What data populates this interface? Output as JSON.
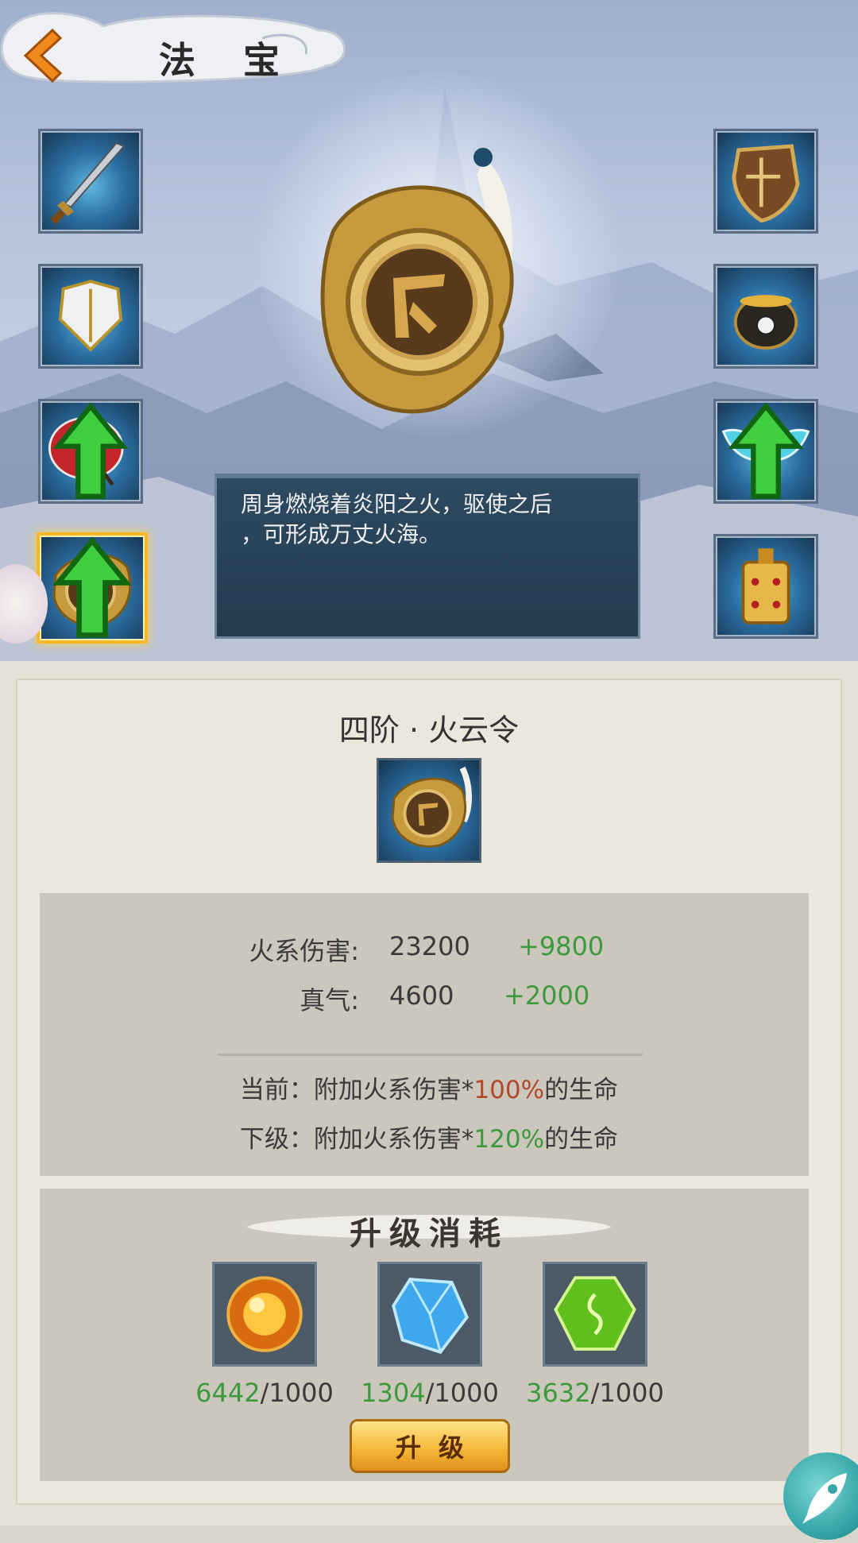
{
  "header": {
    "title": "法 宝",
    "back_icon": "chevron-left-icon"
  },
  "left_slots": [
    {
      "name": "sword",
      "icon": "sword-icon",
      "upgradable": false,
      "selected": false
    },
    {
      "name": "armor",
      "icon": "armor-icon",
      "upgradable": false,
      "selected": false
    },
    {
      "name": "umbrella",
      "icon": "umbrella-icon",
      "upgradable": true,
      "selected": false
    },
    {
      "name": "huoyunling",
      "icon": "medallion-icon",
      "upgradable": true,
      "selected": true
    }
  ],
  "right_slots": [
    {
      "name": "shield",
      "icon": "shield-icon",
      "upgradable": false
    },
    {
      "name": "cauldron",
      "icon": "cauldron-icon",
      "upgradable": false
    },
    {
      "name": "ribbon",
      "icon": "ribbon-icon",
      "upgradable": true
    },
    {
      "name": "bell",
      "icon": "bell-icon",
      "upgradable": false
    }
  ],
  "description": {
    "line1": "周身燃烧着炎阳之火，驱使之后",
    "line2": "，可形成万丈火海。"
  },
  "item": {
    "title": "四阶 · 火云令"
  },
  "stats": [
    {
      "label": "火系伤害:",
      "value": "23200",
      "bonus": "+9800"
    },
    {
      "label": "真气:",
      "value": "4600",
      "bonus": "+2000"
    }
  ],
  "effects": {
    "current": {
      "prefix": "当前：附加火系伤害*",
      "percent": "100%",
      "suffix": "的生命"
    },
    "next": {
      "prefix": "下级：附加火系伤害*",
      "percent": "120%",
      "suffix": "的生命"
    }
  },
  "cost": {
    "title": "升级消耗",
    "materials": [
      {
        "icon": "fire-orb-icon",
        "have": "6442",
        "need": "/1000"
      },
      {
        "icon": "blue-crystal-icon",
        "have": "1304",
        "need": "/1000"
      },
      {
        "icon": "green-gem-icon",
        "have": "3632",
        "need": "/1000"
      }
    ]
  },
  "upgrade_button": {
    "label": "升级"
  },
  "colors": {
    "positive": "#3d9a3c",
    "current_percent": "#b0482a",
    "selected_border": "#f5b82a"
  }
}
